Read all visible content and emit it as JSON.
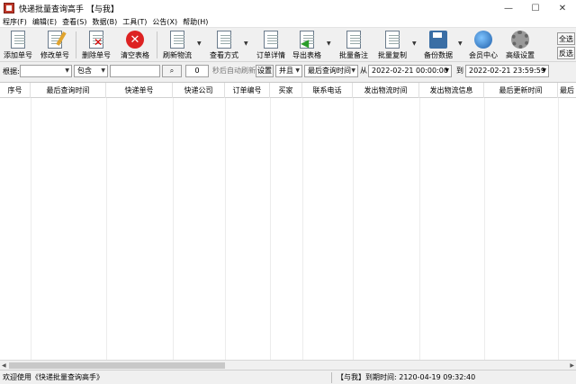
{
  "window": {
    "title": "快递批量查询高手 【与我】",
    "minimize": "—",
    "maximize": "☐",
    "close": "✕"
  },
  "menu": [
    "程序(F)",
    "编辑(E)",
    "查看(S)",
    "数据(B)",
    "工具(T)",
    "公告(X)",
    "帮助(H)"
  ],
  "toolbar": {
    "add": "添加单号",
    "modify": "修改单号",
    "delete": "删除单号",
    "clear": "清空表格",
    "refresh": "刷新物流",
    "view_mode": "查看方式",
    "order_detail": "订单详情",
    "export": "导出表格",
    "batch_note": "批量备注",
    "batch_copy": "批量复制",
    "backup": "备份数据",
    "member": "会员中心",
    "advanced": "高级设置",
    "select_all": "全选",
    "invert": "反选"
  },
  "filter": {
    "basis_label": "根据:",
    "basis_value": "",
    "match_value": "包含",
    "keyword": "",
    "search_icon": "⌕",
    "interval": "0",
    "auto_refresh_label": "秒后自动刷新",
    "settings": "设置",
    "logic_value": "并且",
    "time_field": "最后查询时间",
    "from_label": "从",
    "from_date": "2022-02-21 00:00:00",
    "to_label": "到",
    "to_date": "2022-02-21 23:59:59"
  },
  "table": {
    "columns": [
      "序号",
      "最后查询时间",
      "快递单号",
      "快递公司",
      "订单编号",
      "买家",
      "联系电话",
      "发出物流时间",
      "发出物流信息",
      "最后更新时间",
      "最后"
    ]
  },
  "status": {
    "left": "欢迎使用《快递批量查询高手》",
    "right": "【与我】到期时间: 2120-04-19 09:32:40"
  }
}
